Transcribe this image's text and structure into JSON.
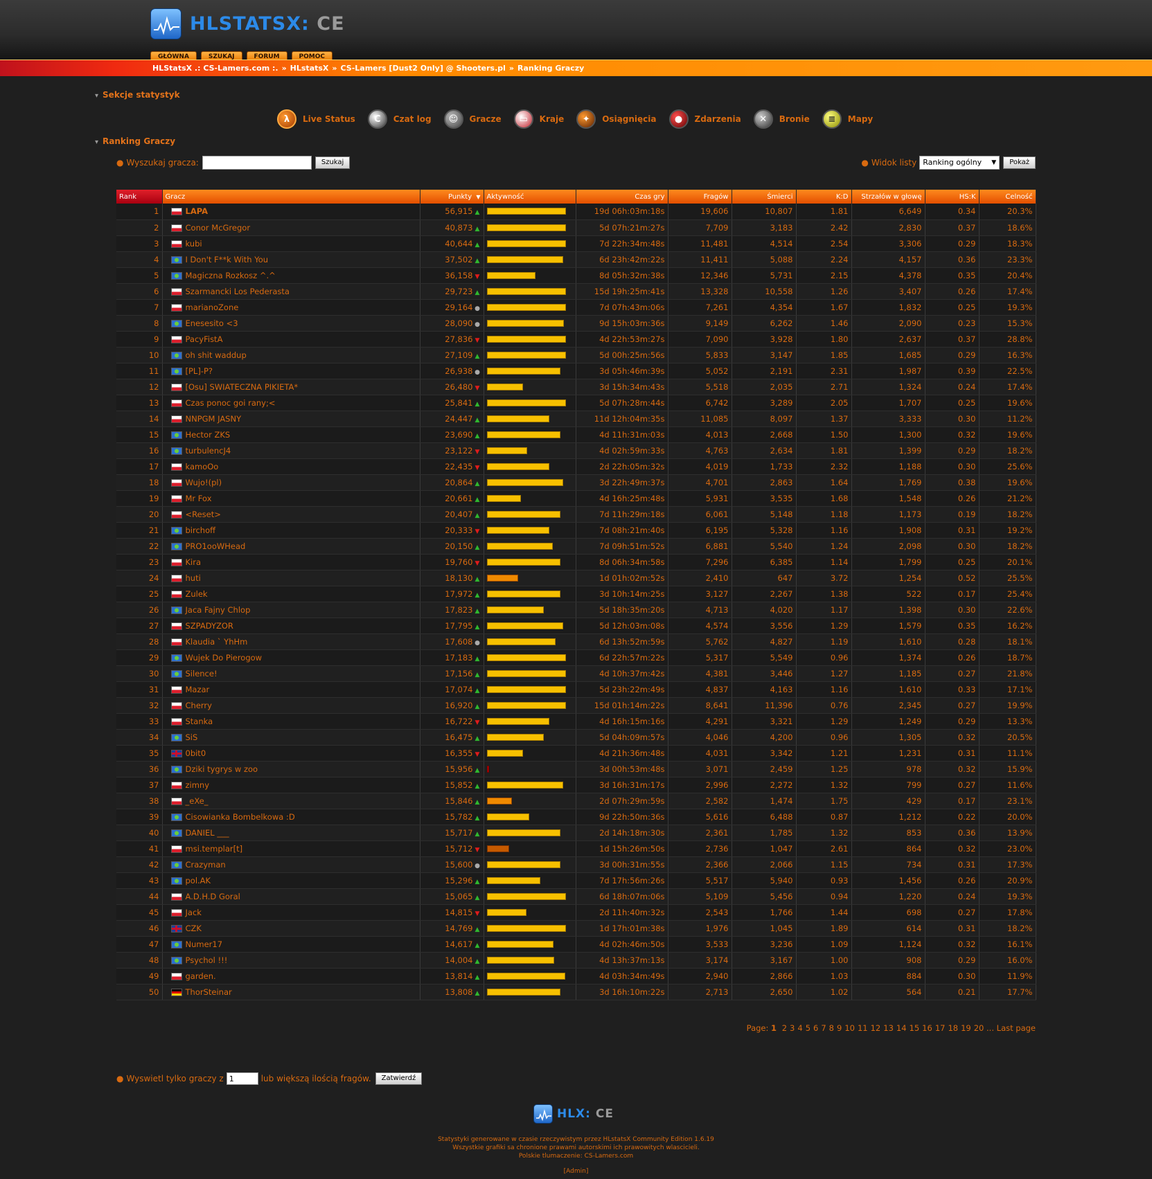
{
  "brand": {
    "name": "HLSTATSX:",
    "edition": "CE"
  },
  "topnav": [
    "GŁÓWNA",
    "SZUKAJ",
    "FORUM",
    "POMOC"
  ],
  "breadcrumbs": [
    "HLStatsX .: CS-Lamers.com :.",
    "HLstatsX",
    "CS-Lamers [Dust2 Only] @ Shooters.pl",
    "Ranking Graczy"
  ],
  "sections_title": "Sekcje statystyk",
  "sections": [
    {
      "label": "Live Status",
      "icon": "half-life-icon"
    },
    {
      "label": "Czat log",
      "icon": "chat-icon"
    },
    {
      "label": "Gracze",
      "icon": "players-icon"
    },
    {
      "label": "Kraje",
      "icon": "countries-icon"
    },
    {
      "label": "Osiągnięcia",
      "icon": "awards-icon"
    },
    {
      "label": "Zdarzenia",
      "icon": "events-icon"
    },
    {
      "label": "Bronie",
      "icon": "weapons-icon"
    },
    {
      "label": "Mapy",
      "icon": "maps-icon"
    }
  ],
  "ranking_title": "Ranking Graczy",
  "search": {
    "label": "Wyszukaj gracza:",
    "value": "",
    "button": "Szukaj"
  },
  "view": {
    "label": "Widok listy",
    "selected": "Ranking ogólny",
    "button": "Pokaż"
  },
  "columns": [
    "Rank",
    "Gracz",
    "Punkty",
    "Aktywność",
    "Czas gry",
    "Fragów",
    "Śmierci",
    "K:D",
    "Strzałów w głowę",
    "HS:K",
    "Celność"
  ],
  "sort_indicator": "▼",
  "rows": [
    {
      "rank": "1",
      "flag": "pl",
      "name": "LAPA",
      "points": "56,915",
      "trend": "up",
      "activity": 0.98,
      "time": "19d 06h:03m:18s",
      "kills": "19,606",
      "deaths": "10,807",
      "kd": "1.81",
      "hs": "6,649",
      "hsk": "0.34",
      "acc": "20.3%"
    },
    {
      "rank": "2",
      "flag": "pl",
      "name": "Conor McGregor",
      "points": "40,873",
      "trend": "up",
      "activity": 0.98,
      "time": "5d 07h:21m:27s",
      "kills": "7,709",
      "deaths": "3,183",
      "kd": "2.42",
      "hs": "2,830",
      "hsk": "0.37",
      "acc": "18.6%"
    },
    {
      "rank": "3",
      "flag": "pl",
      "name": "kubi",
      "points": "40,644",
      "trend": "up",
      "activity": 0.98,
      "time": "7d 22h:34m:48s",
      "kills": "11,481",
      "deaths": "4,514",
      "kd": "2.54",
      "hs": "3,306",
      "hsk": "0.29",
      "acc": "18.3%"
    },
    {
      "rank": "4",
      "flag": "eu",
      "name": "I Don't F**k With You",
      "points": "37,502",
      "trend": "up",
      "activity": 0.95,
      "time": "6d 23h:42m:22s",
      "kills": "11,411",
      "deaths": "5,088",
      "kd": "2.24",
      "hs": "4,157",
      "hsk": "0.36",
      "acc": "23.3%"
    },
    {
      "rank": "5",
      "flag": "eu",
      "name": "Magiczna Rozkosz ^.^",
      "points": "36,158",
      "trend": "down",
      "activity": 0.6,
      "time": "8d 05h:32m:38s",
      "kills": "12,346",
      "deaths": "5,731",
      "kd": "2.15",
      "hs": "4,378",
      "hsk": "0.35",
      "acc": "20.4%"
    },
    {
      "rank": "6",
      "flag": "pl",
      "name": "Szarmancki Los Pederasta",
      "points": "29,723",
      "trend": "up",
      "activity": 0.98,
      "time": "15d 19h:25m:41s",
      "kills": "13,328",
      "deaths": "10,558",
      "kd": "1.26",
      "hs": "3,407",
      "hsk": "0.26",
      "acc": "17.4%"
    },
    {
      "rank": "7",
      "flag": "pl",
      "name": "marianoZone",
      "points": "29,164",
      "trend": "same",
      "activity": 0.98,
      "time": "7d 07h:43m:06s",
      "kills": "7,261",
      "deaths": "4,354",
      "kd": "1.67",
      "hs": "1,832",
      "hsk": "0.25",
      "acc": "19.3%"
    },
    {
      "rank": "8",
      "flag": "eu",
      "name": "Enesesito <3",
      "points": "28,090",
      "trend": "same",
      "activity": 0.96,
      "time": "9d 15h:03m:36s",
      "kills": "9,149",
      "deaths": "6,262",
      "kd": "1.46",
      "hs": "2,090",
      "hsk": "0.23",
      "acc": "15.3%"
    },
    {
      "rank": "9",
      "flag": "pl",
      "name": "PacyFistA",
      "points": "27,836",
      "trend": "down",
      "activity": 0.98,
      "time": "4d 22h:53m:27s",
      "kills": "7,090",
      "deaths": "3,928",
      "kd": "1.80",
      "hs": "2,637",
      "hsk": "0.37",
      "acc": "28.8%"
    },
    {
      "rank": "10",
      "flag": "eu",
      "name": "oh shit waddup",
      "points": "27,109",
      "trend": "up",
      "activity": 0.98,
      "time": "5d 00h:25m:56s",
      "kills": "5,833",
      "deaths": "3,147",
      "kd": "1.85",
      "hs": "1,685",
      "hsk": "0.29",
      "acc": "16.3%"
    },
    {
      "rank": "11",
      "flag": "eu",
      "name": "[PL]-P?",
      "points": "26,938",
      "trend": "same",
      "activity": 0.91,
      "time": "3d 05h:46m:39s",
      "kills": "5,052",
      "deaths": "2,191",
      "kd": "2.31",
      "hs": "1,987",
      "hsk": "0.39",
      "acc": "22.5%"
    },
    {
      "rank": "12",
      "flag": "pl",
      "name": "[Osu] SWIATECZNA PIKIETA*",
      "points": "26,480",
      "trend": "down",
      "activity": 0.45,
      "time": "3d 15h:34m:43s",
      "kills": "5,518",
      "deaths": "2,035",
      "kd": "2.71",
      "hs": "1,324",
      "hsk": "0.24",
      "acc": "17.4%"
    },
    {
      "rank": "13",
      "flag": "pl",
      "name": "Czas ponoc goi rany;<",
      "points": "25,841",
      "trend": "up",
      "activity": 0.98,
      "time": "5d 07h:28m:44s",
      "kills": "6,742",
      "deaths": "3,289",
      "kd": "2.05",
      "hs": "1,707",
      "hsk": "0.25",
      "acc": "19.6%"
    },
    {
      "rank": "14",
      "flag": "pl",
      "name": "NNPGM JASNY",
      "points": "24,447",
      "trend": "up",
      "activity": 0.78,
      "time": "11d 12h:04m:35s",
      "kills": "11,085",
      "deaths": "8,097",
      "kd": "1.37",
      "hs": "3,333",
      "hsk": "0.30",
      "acc": "11.2%"
    },
    {
      "rank": "15",
      "flag": "eu",
      "name": "Hector ZKS",
      "points": "23,690",
      "trend": "up",
      "activity": 0.91,
      "time": "4d 11h:31m:03s",
      "kills": "4,013",
      "deaths": "2,668",
      "kd": "1.50",
      "hs": "1,300",
      "hsk": "0.32",
      "acc": "19.6%"
    },
    {
      "rank": "16",
      "flag": "eu",
      "name": "turbulencJ4",
      "points": "23,122",
      "trend": "down",
      "activity": 0.5,
      "time": "4d 02h:59m:33s",
      "kills": "4,763",
      "deaths": "2,634",
      "kd": "1.81",
      "hs": "1,399",
      "hsk": "0.29",
      "acc": "18.2%"
    },
    {
      "rank": "17",
      "flag": "pl",
      "name": "kamoOo",
      "points": "22,435",
      "trend": "down",
      "activity": 0.78,
      "time": "2d 22h:05m:32s",
      "kills": "4,019",
      "deaths": "1,733",
      "kd": "2.32",
      "hs": "1,188",
      "hsk": "0.30",
      "acc": "25.6%"
    },
    {
      "rank": "18",
      "flag": "pl",
      "name": "Wujo!(pl)",
      "points": "20,864",
      "trend": "up",
      "activity": 0.95,
      "time": "3d 22h:49m:37s",
      "kills": "4,701",
      "deaths": "2,863",
      "kd": "1.64",
      "hs": "1,769",
      "hsk": "0.38",
      "acc": "19.6%"
    },
    {
      "rank": "19",
      "flag": "pl",
      "name": "Mr Fox",
      "points": "20,661",
      "trend": "up",
      "activity": 0.42,
      "time": "4d 16h:25m:48s",
      "kills": "5,931",
      "deaths": "3,535",
      "kd": "1.68",
      "hs": "1,548",
      "hsk": "0.26",
      "acc": "21.2%"
    },
    {
      "rank": "20",
      "flag": "pl",
      "name": "<Reset>",
      "points": "20,407",
      "trend": "up",
      "activity": 0.91,
      "time": "7d 11h:29m:18s",
      "kills": "6,061",
      "deaths": "5,148",
      "kd": "1.18",
      "hs": "1,173",
      "hsk": "0.19",
      "acc": "18.2%"
    },
    {
      "rank": "21",
      "flag": "eu",
      "name": "birchoff",
      "points": "20,333",
      "trend": "down",
      "activity": 0.78,
      "time": "7d 08h:21m:40s",
      "kills": "6,195",
      "deaths": "5,328",
      "kd": "1.16",
      "hs": "1,908",
      "hsk": "0.31",
      "acc": "19.2%"
    },
    {
      "rank": "22",
      "flag": "eu",
      "name": "PRO1ooWHead",
      "points": "20,150",
      "trend": "up",
      "activity": 0.82,
      "time": "7d 09h:51m:52s",
      "kills": "6,881",
      "deaths": "5,540",
      "kd": "1.24",
      "hs": "2,098",
      "hsk": "0.30",
      "acc": "18.2%"
    },
    {
      "rank": "23",
      "flag": "pl",
      "name": "Kira",
      "points": "19,760",
      "trend": "down",
      "activity": 0.91,
      "time": "8d 06h:34m:58s",
      "kills": "7,296",
      "deaths": "6,385",
      "kd": "1.14",
      "hs": "1,799",
      "hsk": "0.25",
      "acc": "20.1%"
    },
    {
      "rank": "24",
      "flag": "pl",
      "name": "huti",
      "points": "18,130",
      "trend": "up",
      "activity": 0.39,
      "level": "mid",
      "time": "1d 01h:02m:52s",
      "kills": "2,410",
      "deaths": "647",
      "kd": "3.72",
      "hs": "1,254",
      "hsk": "0.52",
      "acc": "25.5%"
    },
    {
      "rank": "25",
      "flag": "pl",
      "name": "Zulek",
      "points": "17,972",
      "trend": "up",
      "activity": 0.91,
      "time": "3d 10h:14m:25s",
      "kills": "3,127",
      "deaths": "2,267",
      "kd": "1.38",
      "hs": "522",
      "hsk": "0.17",
      "acc": "25.4%"
    },
    {
      "rank": "26",
      "flag": "eu",
      "name": "Jaca Fajny Chlop",
      "points": "17,823",
      "trend": "up",
      "activity": 0.71,
      "time": "5d 18h:35m:20s",
      "kills": "4,713",
      "deaths": "4,020",
      "kd": "1.17",
      "hs": "1,398",
      "hsk": "0.30",
      "acc": "22.6%"
    },
    {
      "rank": "27",
      "flag": "pl",
      "name": "SZPADYZOR",
      "points": "17,795",
      "trend": "up",
      "activity": 0.95,
      "time": "5d 12h:03m:08s",
      "kills": "4,574",
      "deaths": "3,556",
      "kd": "1.29",
      "hs": "1,579",
      "hsk": "0.35",
      "acc": "16.2%"
    },
    {
      "rank": "28",
      "flag": "pl",
      "name": "Klaudia ` YhHm",
      "points": "17,608",
      "trend": "same",
      "activity": 0.85,
      "time": "6d 13h:52m:59s",
      "kills": "5,762",
      "deaths": "4,827",
      "kd": "1.19",
      "hs": "1,610",
      "hsk": "0.28",
      "acc": "18.1%"
    },
    {
      "rank": "29",
      "flag": "eu",
      "name": "Wujek Do Pierogow",
      "points": "17,183",
      "trend": "up",
      "activity": 0.98,
      "time": "6d 22h:57m:22s",
      "kills": "5,317",
      "deaths": "5,549",
      "kd": "0.96",
      "hs": "1,374",
      "hsk": "0.26",
      "acc": "18.7%"
    },
    {
      "rank": "30",
      "flag": "eu",
      "name": "Silence!",
      "points": "17,156",
      "trend": "up",
      "activity": 0.98,
      "time": "4d 10h:37m:42s",
      "kills": "4,381",
      "deaths": "3,446",
      "kd": "1.27",
      "hs": "1,185",
      "hsk": "0.27",
      "acc": "21.8%"
    },
    {
      "rank": "31",
      "flag": "pl",
      "name": "Mazar",
      "points": "17,074",
      "trend": "up",
      "activity": 0.98,
      "time": "5d 23h:22m:49s",
      "kills": "4,837",
      "deaths": "4,163",
      "kd": "1.16",
      "hs": "1,610",
      "hsk": "0.33",
      "acc": "17.1%"
    },
    {
      "rank": "32",
      "flag": "pl",
      "name": "Cherry",
      "points": "16,920",
      "trend": "up",
      "activity": 0.98,
      "time": "15d 01h:14m:22s",
      "kills": "8,641",
      "deaths": "11,396",
      "kd": "0.76",
      "hs": "2,345",
      "hsk": "0.27",
      "acc": "19.9%"
    },
    {
      "rank": "33",
      "flag": "pl",
      "name": "Stanka",
      "points": "16,722",
      "trend": "down",
      "activity": 0.78,
      "time": "4d 16h:15m:16s",
      "kills": "4,291",
      "deaths": "3,321",
      "kd": "1.29",
      "hs": "1,249",
      "hsk": "0.29",
      "acc": "13.3%"
    },
    {
      "rank": "34",
      "flag": "eu",
      "name": "SiS",
      "points": "16,475",
      "trend": "up",
      "activity": 0.71,
      "time": "5d 04h:09m:57s",
      "kills": "4,046",
      "deaths": "4,200",
      "kd": "0.96",
      "hs": "1,305",
      "hsk": "0.32",
      "acc": "20.5%"
    },
    {
      "rank": "35",
      "flag": "gb",
      "name": "0bit0",
      "points": "16,355",
      "trend": "down",
      "activity": 0.45,
      "time": "4d 21h:36m:48s",
      "kills": "4,031",
      "deaths": "3,342",
      "kd": "1.21",
      "hs": "1,231",
      "hsk": "0.31",
      "acc": "11.1%"
    },
    {
      "rank": "36",
      "flag": "eu",
      "name": "Dziki tygrys w zoo",
      "points": "15,956",
      "trend": "up",
      "activity": 0.03,
      "level": "none",
      "time": "3d 00h:53m:48s",
      "kills": "3,071",
      "deaths": "2,459",
      "kd": "1.25",
      "hs": "978",
      "hsk": "0.32",
      "acc": "15.9%"
    },
    {
      "rank": "37",
      "flag": "pl",
      "name": "zimny",
      "points": "15,852",
      "trend": "up",
      "activity": 0.95,
      "time": "3d 16h:31m:17s",
      "kills": "2,996",
      "deaths": "2,272",
      "kd": "1.32",
      "hs": "799",
      "hsk": "0.27",
      "acc": "11.6%"
    },
    {
      "rank": "38",
      "flag": "pl",
      "name": "_eXe_",
      "points": "15,846",
      "trend": "up",
      "activity": 0.31,
      "level": "mid",
      "time": "2d 07h:29m:59s",
      "kills": "2,582",
      "deaths": "1,474",
      "kd": "1.75",
      "hs": "429",
      "hsk": "0.17",
      "acc": "23.1%"
    },
    {
      "rank": "39",
      "flag": "eu",
      "name": "Cisowianka Bombelkowa :D",
      "points": "15,782",
      "trend": "up",
      "activity": 0.53,
      "time": "9d 22h:50m:36s",
      "kills": "5,616",
      "deaths": "6,488",
      "kd": "0.87",
      "hs": "1,212",
      "hsk": "0.22",
      "acc": "20.0%"
    },
    {
      "rank": "40",
      "flag": "eu",
      "name": "DANIEL ___",
      "points": "15,717",
      "trend": "up",
      "activity": 0.91,
      "time": "2d 14h:18m:30s",
      "kills": "2,361",
      "deaths": "1,785",
      "kd": "1.32",
      "hs": "853",
      "hsk": "0.36",
      "acc": "13.9%"
    },
    {
      "rank": "41",
      "flag": "pl",
      "name": "msi.templar[t]",
      "points": "15,712",
      "trend": "down",
      "activity": 0.28,
      "level": "low",
      "time": "1d 15h:26m:50s",
      "kills": "2,736",
      "deaths": "1,047",
      "kd": "2.61",
      "hs": "864",
      "hsk": "0.32",
      "acc": "23.0%"
    },
    {
      "rank": "42",
      "flag": "eu",
      "name": "Crazyman",
      "points": "15,600",
      "trend": "same",
      "activity": 0.91,
      "time": "3d 00h:31m:55s",
      "kills": "2,366",
      "deaths": "2,066",
      "kd": "1.15",
      "hs": "734",
      "hsk": "0.31",
      "acc": "17.3%"
    },
    {
      "rank": "43",
      "flag": "eu",
      "name": "pol.AK",
      "points": "15,296",
      "trend": "up",
      "activity": 0.66,
      "time": "7d 17h:56m:26s",
      "kills": "5,517",
      "deaths": "5,940",
      "kd": "0.93",
      "hs": "1,456",
      "hsk": "0.26",
      "acc": "20.9%"
    },
    {
      "rank": "44",
      "flag": "pl",
      "name": "A.D.H.D Goral",
      "points": "15,065",
      "trend": "up",
      "activity": 0.98,
      "time": "6d 18h:07m:06s",
      "kills": "5,109",
      "deaths": "5,456",
      "kd": "0.94",
      "hs": "1,220",
      "hsk": "0.24",
      "acc": "19.3%"
    },
    {
      "rank": "45",
      "flag": "pl",
      "name": "Jack",
      "points": "14,815",
      "trend": "down",
      "activity": 0.49,
      "time": "2d 11h:40m:32s",
      "kills": "2,543",
      "deaths": "1,766",
      "kd": "1.44",
      "hs": "698",
      "hsk": "0.27",
      "acc": "17.8%"
    },
    {
      "rank": "46",
      "flag": "gb",
      "name": "CZK",
      "points": "14,769",
      "trend": "up",
      "activity": 0.98,
      "time": "1d 17h:01m:38s",
      "kills": "1,976",
      "deaths": "1,045",
      "kd": "1.89",
      "hs": "614",
      "hsk": "0.31",
      "acc": "18.2%"
    },
    {
      "rank": "47",
      "flag": "eu",
      "name": "Numer17",
      "points": "14,617",
      "trend": "up",
      "activity": 0.83,
      "time": "4d 02h:46m:50s",
      "kills": "3,533",
      "deaths": "3,236",
      "kd": "1.09",
      "hs": "1,124",
      "hsk": "0.32",
      "acc": "16.1%"
    },
    {
      "rank": "48",
      "flag": "eu",
      "name": "Psychol !!!",
      "points": "14,004",
      "trend": "up",
      "activity": 0.84,
      "time": "4d 13h:37m:13s",
      "kills": "3,174",
      "deaths": "3,167",
      "kd": "1.00",
      "hs": "908",
      "hsk": "0.29",
      "acc": "16.0%"
    },
    {
      "rank": "49",
      "flag": "pl",
      "name": "garden.",
      "points": "13,814",
      "trend": "up",
      "activity": 0.97,
      "time": "4d 03h:34m:49s",
      "kills": "2,940",
      "deaths": "2,866",
      "kd": "1.03",
      "hs": "884",
      "hsk": "0.30",
      "acc": "11.9%"
    },
    {
      "rank": "50",
      "flag": "de",
      "name": "ThorSteinar",
      "points": "13,808",
      "trend": "up",
      "activity": 0.91,
      "time": "3d 16h:10m:22s",
      "kills": "2,713",
      "deaths": "2,650",
      "kd": "1.02",
      "hs": "564",
      "hsk": "0.21",
      "acc": "17.7%"
    }
  ],
  "pagination": {
    "label": "Page:",
    "current": "1",
    "pages": [
      "2",
      "3",
      "4",
      "5",
      "6",
      "7",
      "8",
      "9",
      "10",
      "11",
      "12",
      "13",
      "14",
      "15",
      "16",
      "17",
      "18",
      "19",
      "20"
    ],
    "ellipsis": "...",
    "last": "Last page"
  },
  "minfrags": {
    "label_before": "Wyswietl tylko graczy z",
    "value": "1",
    "label_after": "lub większą ilością fragów.",
    "button": "Zatwierdź"
  },
  "footer": {
    "logo": "HLX:",
    "logo_ce": "CE",
    "line1": "Statystyki generowane w czasie rzeczywistym przez HLstatsX Community Edition 1.6.19",
    "line2": "Wszystkie grafiki sa chronione prawami autorskimi ich prawowitych wlascicieli.",
    "line3": "Polskie tlumaczenie: CS-Lamers.com",
    "admin": "[Admin]"
  },
  "colors": {
    "accent": "#d86a10",
    "header_orange": "#ff8a1e",
    "bar_yellow": "#f7c000",
    "background": "#1f1f1f"
  }
}
